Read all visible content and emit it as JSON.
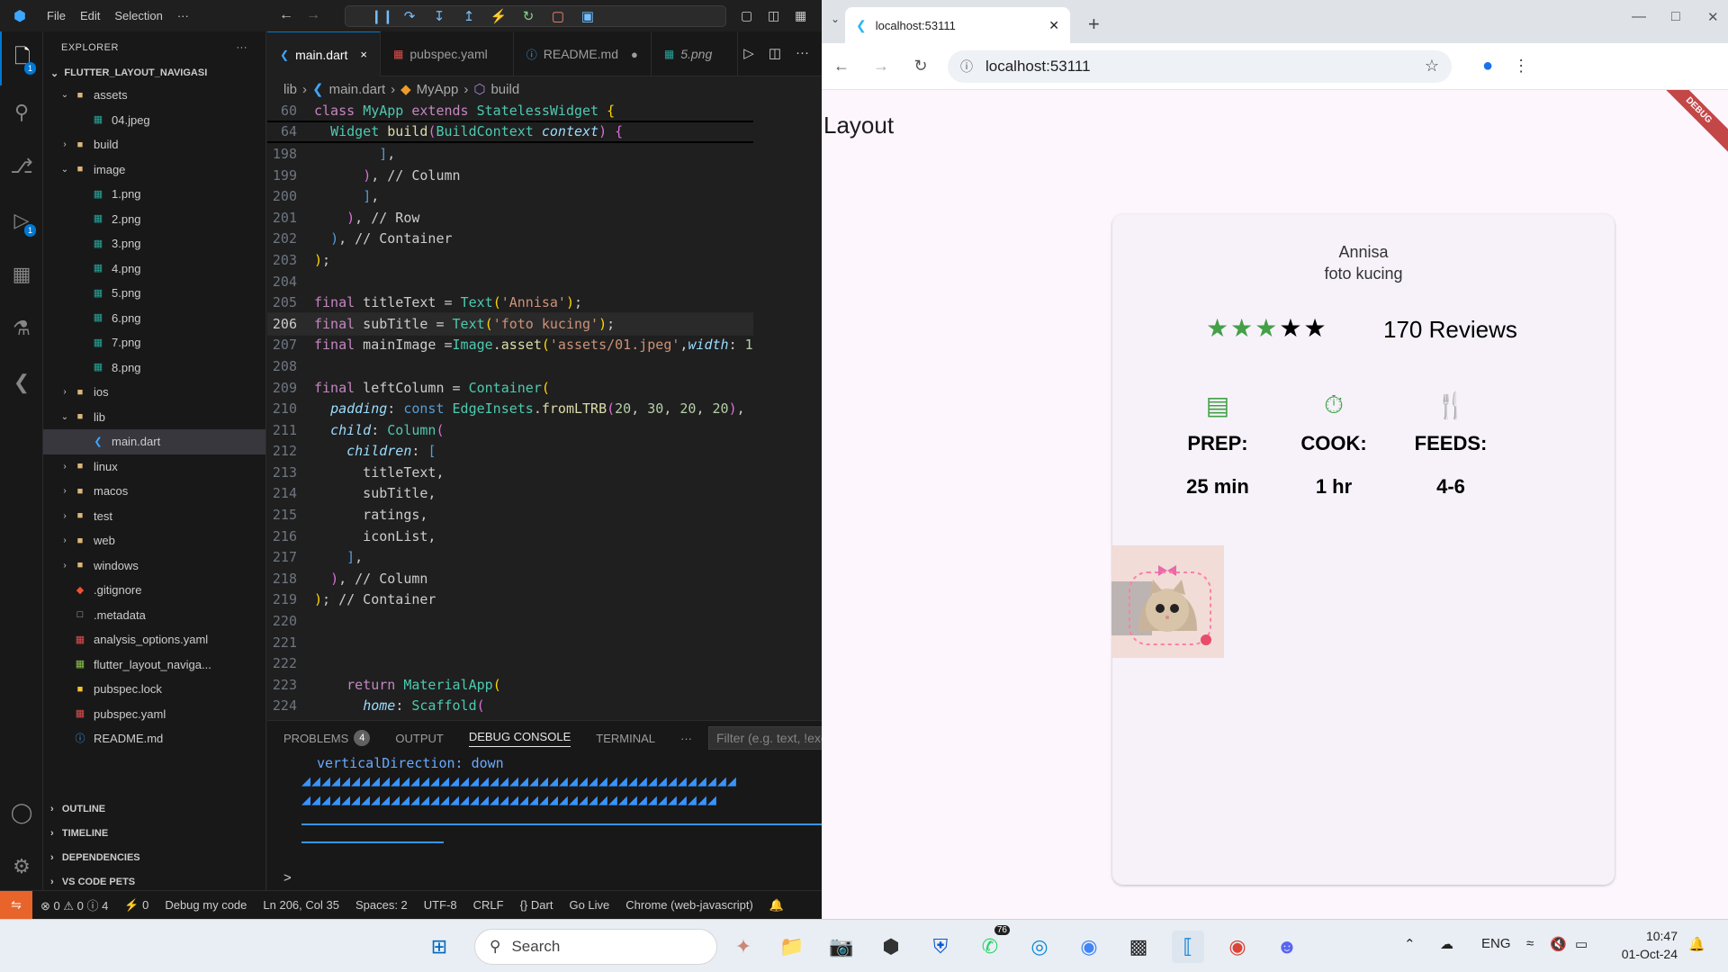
{
  "vscode": {
    "menu": [
      "File",
      "Edit",
      "Selection",
      "···"
    ],
    "explorer_title": "EXPLORER",
    "root": "FLUTTER_LAYOUT_NAVIGASI",
    "tree": [
      {
        "label": "assets",
        "depth": 1,
        "type": "folder",
        "open": true
      },
      {
        "label": "04.jpeg",
        "depth": 2,
        "type": "img"
      },
      {
        "label": "build",
        "depth": 1,
        "type": "folder"
      },
      {
        "label": "image",
        "depth": 1,
        "type": "folder",
        "open": true
      },
      {
        "label": "1.png",
        "depth": 2,
        "type": "img"
      },
      {
        "label": "2.png",
        "depth": 2,
        "type": "img"
      },
      {
        "label": "3.png",
        "depth": 2,
        "type": "img"
      },
      {
        "label": "4.png",
        "depth": 2,
        "type": "img"
      },
      {
        "label": "5.png",
        "depth": 2,
        "type": "img"
      },
      {
        "label": "6.png",
        "depth": 2,
        "type": "img"
      },
      {
        "label": "7.png",
        "depth": 2,
        "type": "img"
      },
      {
        "label": "8.png",
        "depth": 2,
        "type": "img"
      },
      {
        "label": "ios",
        "depth": 1,
        "type": "folder"
      },
      {
        "label": "lib",
        "depth": 1,
        "type": "folder",
        "open": true
      },
      {
        "label": "main.dart",
        "depth": 2,
        "type": "dart",
        "selected": true
      },
      {
        "label": "linux",
        "depth": 1,
        "type": "folder"
      },
      {
        "label": "macos",
        "depth": 1,
        "type": "folder"
      },
      {
        "label": "test",
        "depth": 1,
        "type": "folder"
      },
      {
        "label": "web",
        "depth": 1,
        "type": "folder"
      },
      {
        "label": "windows",
        "depth": 1,
        "type": "folder"
      },
      {
        "label": ".gitignore",
        "depth": 1,
        "type": "git"
      },
      {
        "label": ".metadata",
        "depth": 1,
        "type": "file"
      },
      {
        "label": "analysis_options.yaml",
        "depth": 1,
        "type": "yaml"
      },
      {
        "label": "flutter_layout_naviga...",
        "depth": 1,
        "type": "iml"
      },
      {
        "label": "pubspec.lock",
        "depth": 1,
        "type": "lock"
      },
      {
        "label": "pubspec.yaml",
        "depth": 1,
        "type": "yaml"
      },
      {
        "label": "README.md",
        "depth": 1,
        "type": "md"
      }
    ],
    "sections": [
      "OUTLINE",
      "TIMELINE",
      "DEPENDENCIES",
      "VS CODE PETS"
    ],
    "tabs": [
      {
        "label": "main.dart",
        "active": true,
        "icon": "dart-icon",
        "end": "×"
      },
      {
        "label": "pubspec.yaml",
        "icon": "yaml-icon",
        "end": ""
      },
      {
        "label": "README.md",
        "icon": "info-icon",
        "end": "●"
      },
      {
        "label": "5.png",
        "icon": "image-icon",
        "end": ""
      }
    ],
    "breadcrumb": [
      "lib",
      "main.dart",
      "MyApp",
      "build"
    ],
    "badges": {
      "explorer": "1",
      "debug": "1"
    },
    "panel": {
      "tabs": [
        "PROBLEMS",
        "OUTPUT",
        "DEBUG CONSOLE",
        "TERMINAL",
        "···"
      ],
      "problems_count": "4",
      "filter_placeholder": "Filter (e.g. text, !excl...",
      "console_line": "verticalDirection: down",
      "prompt": ">"
    },
    "status": [
      "⊗ 0 ⚠ 0 ⓘ 4",
      "⚡ 0",
      "Debug my code",
      "Ln 206, Col 35",
      "Spaces: 2",
      "UTF-8",
      "CRLF",
      "{} Dart",
      "Go Live",
      "Chrome (web-javascript)"
    ]
  },
  "chrome": {
    "tab_title": "localhost:53111",
    "url": "localhost:53111"
  },
  "app": {
    "title": "Layout",
    "debug": "DEBUG",
    "name": "Annisa",
    "subtitle": "foto kucing",
    "stars_filled": 3,
    "stars_total": 5,
    "reviews": "170 Reviews",
    "columns": [
      {
        "label": "PREP:",
        "value": "25 min",
        "icon": "kitchen-icon"
      },
      {
        "label": "COOK:",
        "value": "1 hr",
        "icon": "timer-icon"
      },
      {
        "label": "FEEDS:",
        "value": "4-6",
        "icon": "restaurant-icon"
      }
    ]
  },
  "taskbar": {
    "search": "Search",
    "whatsapp_badge": "76",
    "lang": "ENG",
    "time": "10:47",
    "date": "01-Oct-24"
  }
}
